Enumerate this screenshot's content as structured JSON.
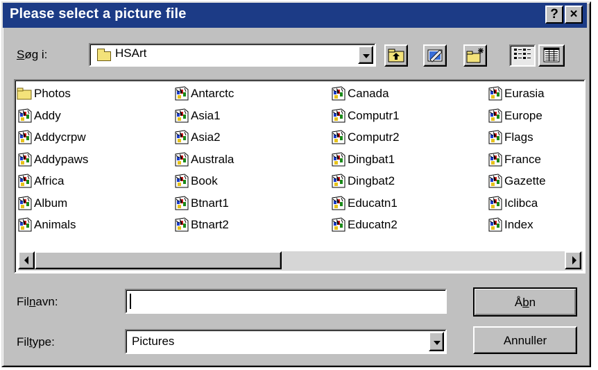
{
  "window": {
    "title": "Please select a picture file",
    "help_label": "?",
    "close_label": "×"
  },
  "lookin": {
    "label_u": "S",
    "label_rest": "øg i:",
    "value": "HSArt"
  },
  "files": [
    {
      "name": "Photos",
      "type": "folder"
    },
    {
      "name": "Addy",
      "type": "picture"
    },
    {
      "name": "Addycrpw",
      "type": "picture"
    },
    {
      "name": "Addypaws",
      "type": "picture"
    },
    {
      "name": "Africa",
      "type": "picture"
    },
    {
      "name": "Album",
      "type": "picture"
    },
    {
      "name": "Animals",
      "type": "picture"
    },
    {
      "name": "Antarctc",
      "type": "picture"
    },
    {
      "name": "Asia1",
      "type": "picture"
    },
    {
      "name": "Asia2",
      "type": "picture"
    },
    {
      "name": "Australa",
      "type": "picture"
    },
    {
      "name": "Book",
      "type": "picture"
    },
    {
      "name": "Btnart1",
      "type": "picture"
    },
    {
      "name": "Btnart2",
      "type": "picture"
    },
    {
      "name": "Canada",
      "type": "picture"
    },
    {
      "name": "Computr1",
      "type": "picture"
    },
    {
      "name": "Computr2",
      "type": "picture"
    },
    {
      "name": "Dingbat1",
      "type": "picture"
    },
    {
      "name": "Dingbat2",
      "type": "picture"
    },
    {
      "name": "Educatn1",
      "type": "picture"
    },
    {
      "name": "Educatn2",
      "type": "picture"
    },
    {
      "name": "Eurasia",
      "type": "picture"
    },
    {
      "name": "Europe",
      "type": "picture"
    },
    {
      "name": "Flags",
      "type": "picture"
    },
    {
      "name": "France",
      "type": "picture"
    },
    {
      "name": "Gazette",
      "type": "picture"
    },
    {
      "name": "Iclibca",
      "type": "picture"
    },
    {
      "name": "Index",
      "type": "picture"
    }
  ],
  "filename": {
    "label_a": "Fil",
    "label_u": "n",
    "label_b": "avn:",
    "value": ""
  },
  "filetype": {
    "label_a": "Fil",
    "label_u": "t",
    "label_b": "ype:",
    "value": "Pictures"
  },
  "buttons": {
    "open_a": "Å",
    "open_u": "b",
    "open_b": "n",
    "cancel": "Annuller"
  },
  "colors": {
    "titlebar": "#1c3b86",
    "face": "#c0c0c0"
  }
}
